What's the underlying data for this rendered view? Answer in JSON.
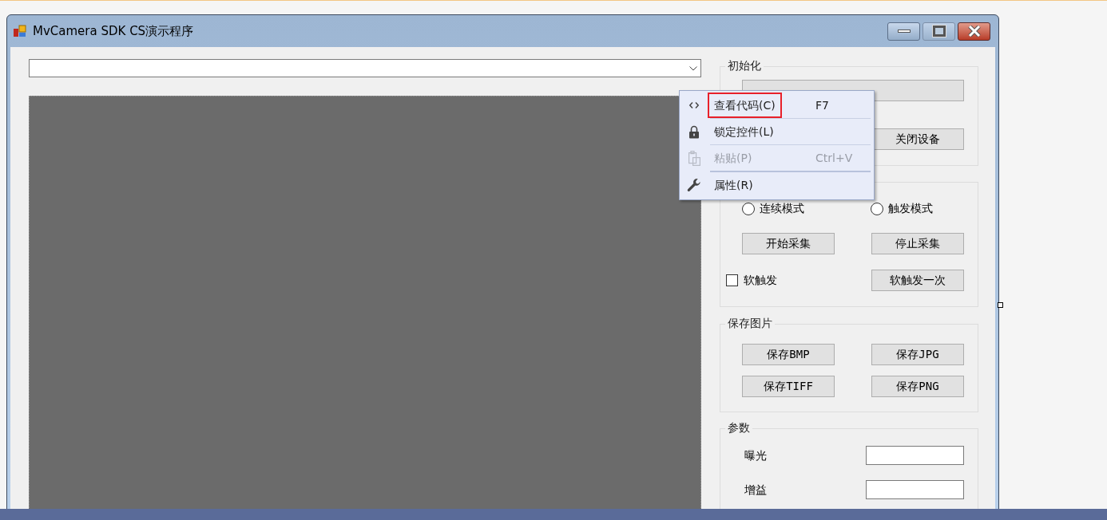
{
  "window": {
    "title": "MvCamera SDK CS演示程序"
  },
  "init_group": {
    "title": "初始化",
    "buttons": [
      "关闭设备"
    ]
  },
  "acquisition_group": {
    "radios": [
      {
        "label": "连续模式",
        "selected": false
      },
      {
        "label": "触发模式",
        "selected": false
      }
    ],
    "buttons": [
      "开始采集",
      "停止采集"
    ],
    "soft_trigger_checkbox": {
      "label": "软触发",
      "checked": false
    },
    "soft_trigger_button": "软触发一次"
  },
  "save_group": {
    "title": "保存图片",
    "buttons": [
      "保存BMP",
      "保存JPG",
      "保存TIFF",
      "保存PNG"
    ]
  },
  "params_group": {
    "title": "参数",
    "fields": [
      {
        "label": "曝光"
      },
      {
        "label": "增益"
      }
    ]
  },
  "context_menu": {
    "items": [
      {
        "label": "查看代码(C)",
        "shortcut": "F7",
        "disabled": false,
        "highlighted": true
      },
      {
        "label": "锁定控件(L)",
        "disabled": false,
        "highlighted": false
      },
      {
        "label": "粘贴(P)",
        "shortcut": "Ctrl+V",
        "disabled": true,
        "highlighted": false
      },
      {
        "label": "属性(R)",
        "disabled": false,
        "highlighted": false
      }
    ]
  }
}
